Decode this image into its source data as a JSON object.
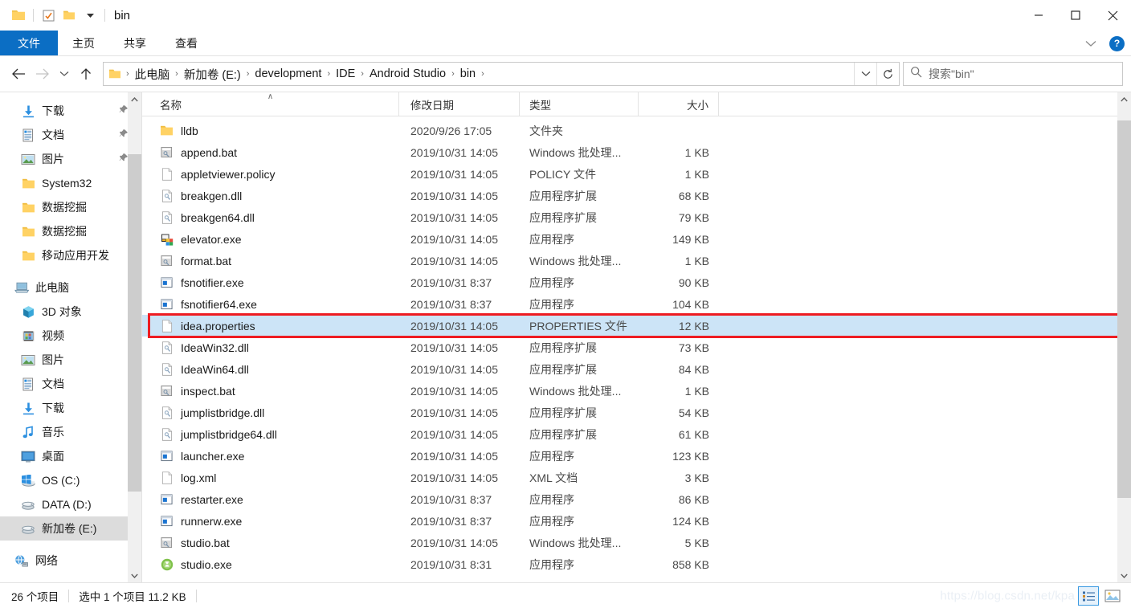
{
  "window": {
    "title": "bin",
    "qat_icons": [
      "folder-icon",
      "checkbox-icon",
      "folder-icon",
      "dropdown-caret-icon"
    ],
    "minimize_label": "—",
    "maximize_label": "□",
    "close_label": "✕"
  },
  "ribbon": {
    "tabs": [
      {
        "label": "文件",
        "name": "tab-file",
        "active": true
      },
      {
        "label": "主页",
        "name": "tab-home",
        "active": false
      },
      {
        "label": "共享",
        "name": "tab-share",
        "active": false
      },
      {
        "label": "查看",
        "name": "tab-view",
        "active": false
      }
    ],
    "collapse_caret": "∨",
    "help_label": "?"
  },
  "addressbar": {
    "back_label": "←",
    "forward_label": "→",
    "recent_label": "∨",
    "up_label": "↑",
    "crumbs": [
      "此电脑",
      "新加卷 (E:)",
      "development",
      "IDE",
      "Android Studio",
      "bin"
    ],
    "crumb_separator": "›",
    "dropdown_label": "∨",
    "refresh_label": "↻",
    "search_placeholder": "搜索\"bin\"",
    "search_value": ""
  },
  "navpane": {
    "items": [
      {
        "label": "下载",
        "icon": "download-icon",
        "pinned": true,
        "level": 2,
        "selected": false
      },
      {
        "label": "文档",
        "icon": "document-icon",
        "pinned": true,
        "level": 2,
        "selected": false
      },
      {
        "label": "图片",
        "icon": "picture-icon",
        "pinned": true,
        "level": 2,
        "selected": false
      },
      {
        "label": "System32",
        "icon": "folder-icon",
        "pinned": false,
        "level": 2,
        "selected": false
      },
      {
        "label": "数据挖掘",
        "icon": "folder-icon",
        "pinned": false,
        "level": 2,
        "selected": false
      },
      {
        "label": "数据挖掘",
        "icon": "folder-icon",
        "pinned": false,
        "level": 2,
        "selected": false
      },
      {
        "label": "移动应用开发",
        "icon": "folder-icon",
        "pinned": false,
        "level": 2,
        "selected": false
      },
      {
        "label": "__GAP__",
        "icon": "",
        "pinned": false,
        "level": 0,
        "selected": false
      },
      {
        "label": "此电脑",
        "icon": "this-pc-icon",
        "pinned": false,
        "level": 1,
        "selected": false
      },
      {
        "label": "3D 对象",
        "icon": "3d-objects-icon",
        "pinned": false,
        "level": 2,
        "selected": false
      },
      {
        "label": "视频",
        "icon": "video-icon",
        "pinned": false,
        "level": 2,
        "selected": false
      },
      {
        "label": "图片",
        "icon": "picture-icon",
        "pinned": false,
        "level": 2,
        "selected": false
      },
      {
        "label": "文档",
        "icon": "document-icon",
        "pinned": false,
        "level": 2,
        "selected": false
      },
      {
        "label": "下载",
        "icon": "download-icon",
        "pinned": false,
        "level": 2,
        "selected": false
      },
      {
        "label": "音乐",
        "icon": "music-icon",
        "pinned": false,
        "level": 2,
        "selected": false
      },
      {
        "label": "桌面",
        "icon": "desktop-icon",
        "pinned": false,
        "level": 2,
        "selected": false
      },
      {
        "label": "OS (C:)",
        "icon": "windows-drive-icon",
        "pinned": false,
        "level": 2,
        "selected": false
      },
      {
        "label": "DATA (D:)",
        "icon": "drive-icon",
        "pinned": false,
        "level": 2,
        "selected": false
      },
      {
        "label": "新加卷 (E:)",
        "icon": "drive-icon",
        "pinned": false,
        "level": 2,
        "selected": true
      },
      {
        "label": "__GAP__",
        "icon": "",
        "pinned": false,
        "level": 0,
        "selected": false
      },
      {
        "label": "网络",
        "icon": "network-icon",
        "pinned": false,
        "level": 1,
        "selected": false
      }
    ]
  },
  "filelist": {
    "columns": [
      {
        "label": "名称",
        "name": "column-name",
        "sorted": true,
        "sort_mark": "∧"
      },
      {
        "label": "修改日期",
        "name": "column-date-modified",
        "sorted": false,
        "sort_mark": ""
      },
      {
        "label": "类型",
        "name": "column-type",
        "sorted": false,
        "sort_mark": ""
      },
      {
        "label": "大小",
        "name": "column-size",
        "sorted": false,
        "sort_mark": ""
      }
    ],
    "rows": [
      {
        "name": "lldb",
        "date": "2020/9/26 17:05",
        "type": "文件夹",
        "size": "",
        "icon": "folder-icon",
        "selected": false
      },
      {
        "name": "append.bat",
        "date": "2019/10/31 14:05",
        "type": "Windows 批处理...",
        "size": "1 KB",
        "icon": "bat-file-icon",
        "selected": false
      },
      {
        "name": "appletviewer.policy",
        "date": "2019/10/31 14:05",
        "type": "POLICY 文件",
        "size": "1 KB",
        "icon": "blank-file-icon",
        "selected": false
      },
      {
        "name": "breakgen.dll",
        "date": "2019/10/31 14:05",
        "type": "应用程序扩展",
        "size": "68 KB",
        "icon": "dll-file-icon",
        "selected": false
      },
      {
        "name": "breakgen64.dll",
        "date": "2019/10/31 14:05",
        "type": "应用程序扩展",
        "size": "79 KB",
        "icon": "dll-file-icon",
        "selected": false
      },
      {
        "name": "elevator.exe",
        "date": "2019/10/31 14:05",
        "type": "应用程序",
        "size": "149 KB",
        "icon": "elevator-exe-icon",
        "selected": false
      },
      {
        "name": "format.bat",
        "date": "2019/10/31 14:05",
        "type": "Windows 批处理...",
        "size": "1 KB",
        "icon": "bat-file-icon",
        "selected": false
      },
      {
        "name": "fsnotifier.exe",
        "date": "2019/10/31 8:37",
        "type": "应用程序",
        "size": "90 KB",
        "icon": "exe-file-icon",
        "selected": false
      },
      {
        "name": "fsnotifier64.exe",
        "date": "2019/10/31 8:37",
        "type": "应用程序",
        "size": "104 KB",
        "icon": "exe-file-icon",
        "selected": false
      },
      {
        "name": "idea.properties",
        "date": "2019/10/31 14:05",
        "type": "PROPERTIES 文件",
        "size": "12 KB",
        "icon": "blank-file-icon",
        "selected": true
      },
      {
        "name": "IdeaWin32.dll",
        "date": "2019/10/31 14:05",
        "type": "应用程序扩展",
        "size": "73 KB",
        "icon": "dll-file-icon",
        "selected": false
      },
      {
        "name": "IdeaWin64.dll",
        "date": "2019/10/31 14:05",
        "type": "应用程序扩展",
        "size": "84 KB",
        "icon": "dll-file-icon",
        "selected": false
      },
      {
        "name": "inspect.bat",
        "date": "2019/10/31 14:05",
        "type": "Windows 批处理...",
        "size": "1 KB",
        "icon": "bat-file-icon",
        "selected": false
      },
      {
        "name": "jumplistbridge.dll",
        "date": "2019/10/31 14:05",
        "type": "应用程序扩展",
        "size": "54 KB",
        "icon": "dll-file-icon",
        "selected": false
      },
      {
        "name": "jumplistbridge64.dll",
        "date": "2019/10/31 14:05",
        "type": "应用程序扩展",
        "size": "61 KB",
        "icon": "dll-file-icon",
        "selected": false
      },
      {
        "name": "launcher.exe",
        "date": "2019/10/31 14:05",
        "type": "应用程序",
        "size": "123 KB",
        "icon": "exe-file-icon",
        "selected": false
      },
      {
        "name": "log.xml",
        "date": "2019/10/31 14:05",
        "type": "XML 文档",
        "size": "3 KB",
        "icon": "blank-file-icon",
        "selected": false
      },
      {
        "name": "restarter.exe",
        "date": "2019/10/31 8:37",
        "type": "应用程序",
        "size": "86 KB",
        "icon": "exe-file-icon",
        "selected": false
      },
      {
        "name": "runnerw.exe",
        "date": "2019/10/31 8:37",
        "type": "应用程序",
        "size": "124 KB",
        "icon": "exe-file-icon",
        "selected": false
      },
      {
        "name": "studio.bat",
        "date": "2019/10/31 14:05",
        "type": "Windows 批处理...",
        "size": "5 KB",
        "icon": "bat-file-icon",
        "selected": false
      },
      {
        "name": "studio.exe",
        "date": "2019/10/31 8:31",
        "type": "应用程序",
        "size": "858 KB",
        "icon": "android-studio-icon",
        "selected": false
      }
    ]
  },
  "statusbar": {
    "item_count": "26 个项目",
    "selection": "选中 1 个项目  11.2 KB",
    "watermark": "https://blog.csdn.net/kpa"
  },
  "colors": {
    "accent": "#0b6ec4",
    "selection": "#cce4f7",
    "highlight_box": "#ee1c22",
    "folder": "#ffd264",
    "nav_selected": "#dcdcdc"
  }
}
